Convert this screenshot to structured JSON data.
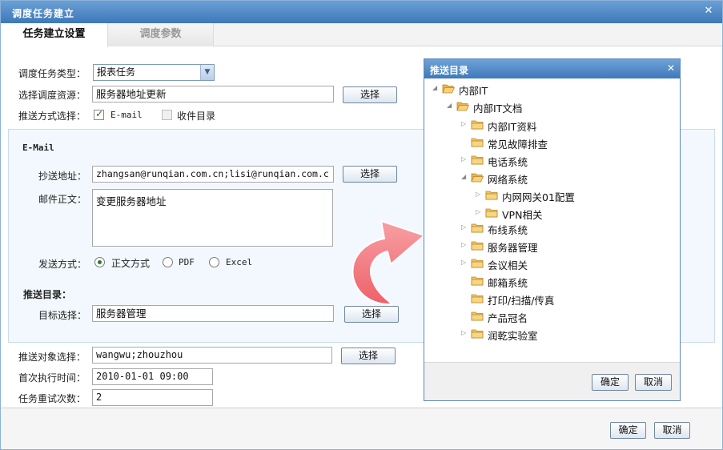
{
  "window": {
    "title": "调度任务建立"
  },
  "tabs": [
    {
      "label": "任务建立设置"
    },
    {
      "label": "调度参数"
    }
  ],
  "form": {
    "task_type_label": "调度任务类型：",
    "task_type_value": "报表任务",
    "resource_label": "选择调度资源：",
    "resource_value": "服务器地址更新",
    "resource_button": "选择",
    "push_method_label": "推送方式选择：",
    "email_option": "E-mail",
    "inbox_option": "收件目录"
  },
  "email": {
    "section_title": "E-Mail",
    "cc_label": "抄送地址：",
    "cc_value": "zhangsan@runqian.com.cn;lisi@runqian.com.c",
    "cc_button": "选择",
    "body_label": "邮件正文：",
    "body_value": "变更服务器地址",
    "send_mode_label": "发送方式：",
    "send_modes": [
      "正文方式",
      "PDF",
      "Excel"
    ]
  },
  "push_dir": {
    "section_title": "推送目录：",
    "target_label": "目标选择：",
    "target_value": "服务器管理",
    "target_button": "选择"
  },
  "lower": {
    "recipients_label": "推送对象选择：",
    "recipients_value": "wangwu;zhouzhou",
    "recipients_button": "选择",
    "first_run_label": "首次执行时间：",
    "first_run_value": "2010-01-01 09:00",
    "retry_label": "任务重试次数：",
    "retry_value": "2"
  },
  "footer": {
    "ok": "确定",
    "cancel": "取消"
  },
  "popup": {
    "title": "推送目录",
    "ok": "确定",
    "cancel": "取消",
    "tree": [
      {
        "label": "内部IT"
      },
      {
        "label": "内部IT文档"
      },
      {
        "label": "内部IT资料"
      },
      {
        "label": "常见故障排查"
      },
      {
        "label": "电话系统"
      },
      {
        "label": "网络系统"
      },
      {
        "label": "内网网关01配置"
      },
      {
        "label": "VPN相关"
      },
      {
        "label": "布线系统"
      },
      {
        "label": "服务器管理"
      },
      {
        "label": "会议相关"
      },
      {
        "label": "邮箱系统"
      },
      {
        "label": "打印/扫描/传真"
      },
      {
        "label": "产品冠名"
      },
      {
        "label": "润乾实验室"
      }
    ]
  },
  "colors": {
    "titlebar": "#3e78b9",
    "accent_arrow": "#f2787e",
    "group_bg": "#f2f8fd"
  }
}
